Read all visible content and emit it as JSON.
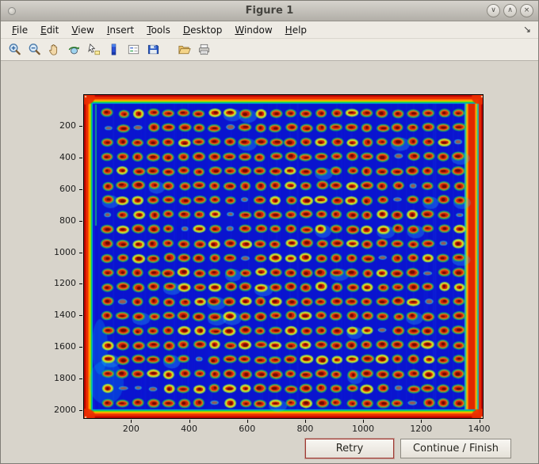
{
  "window": {
    "title": "Figure 1",
    "controls": [
      {
        "name": "shade-button",
        "glyph": "∨"
      },
      {
        "name": "maximize-button",
        "glyph": "∧"
      },
      {
        "name": "close-button",
        "glyph": "×"
      }
    ]
  },
  "menubar": {
    "items": [
      "File",
      "Edit",
      "View",
      "Insert",
      "Tools",
      "Desktop",
      "Window",
      "Help"
    ],
    "dock_icon": "↘"
  },
  "toolbar": {
    "icons": [
      "zoom-in",
      "zoom-out",
      "pan",
      "rotate-3d",
      "data-cursor",
      "insert-colorbar",
      "insert-legend",
      "save",
      "open",
      "print"
    ]
  },
  "figure": {
    "buttons": {
      "retry": "Retry",
      "continue": "Continue / Finish"
    }
  },
  "chart_data": {
    "type": "heatmap",
    "title": "",
    "xlabel": "",
    "ylabel": "",
    "colormap": "jet",
    "x_ticks": [
      200,
      400,
      600,
      800,
      1000,
      1200,
      1400
    ],
    "y_ticks": [
      200,
      400,
      600,
      800,
      1000,
      1200,
      1400,
      1600,
      1800,
      2000
    ],
    "x_range": [
      35,
      1415
    ],
    "y_range": [
      0,
      2055
    ],
    "description": "Scanned microarray plate rendered with jet colormap: dark blue field, rectangular grid of red spots with green halos, saturated red-orange border and a red vertical band along the right edge",
    "spot_grid": {
      "cols": 24,
      "rows": 21
    },
    "colors": {
      "background": "#0a14cf",
      "spot_core": "#cc2008",
      "spot_dark": "#6e0a00",
      "spot_mid": "#f07018",
      "spot_bright": "#f5d820",
      "spot_ring": "#1ec350",
      "border": "#e82800",
      "band": "#e02800"
    }
  }
}
